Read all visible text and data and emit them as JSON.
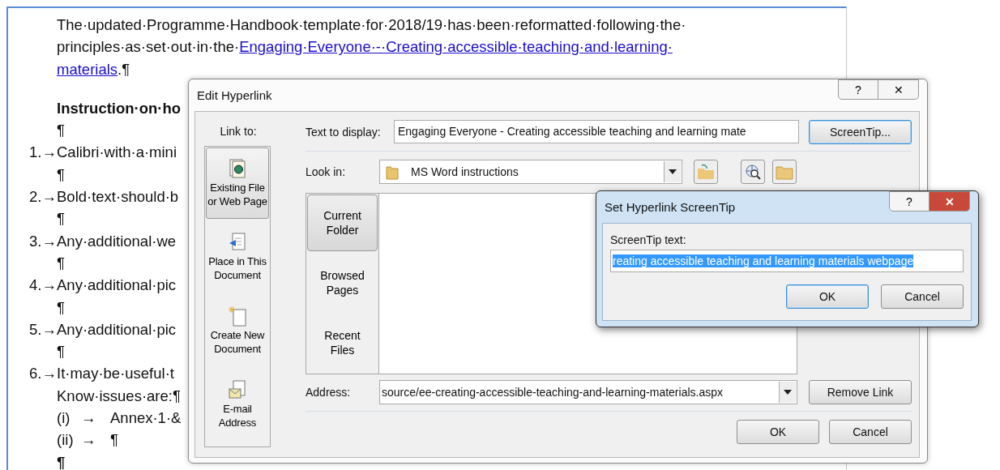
{
  "document": {
    "intro": {
      "line1": "The·updated·Programme·Handbook·template·for·2018/19·has·been·reformatted·following·the·",
      "line2": "principles·as·set·out·in·the·",
      "link_part1": "Engaging·Everyone·-·Creating·accessible·teaching·and·learning·",
      "link_part2": "materials",
      "after": ".¶"
    },
    "lines": [
      {
        "kind": "heading",
        "text": "Instruction·on·ho"
      },
      {
        "kind": "pilcrow",
        "text": "¶"
      },
      {
        "kind": "numbered",
        "number": "1.→",
        "text": "Calibri·with·a·mini"
      },
      {
        "kind": "pilcrow",
        "text": "¶"
      },
      {
        "kind": "numbered",
        "number": "2.→",
        "text": "Bold·text·should·b"
      },
      {
        "kind": "pilcrow",
        "text": "¶"
      },
      {
        "kind": "numbered",
        "number": "3.→",
        "text": "Any·additional·we"
      },
      {
        "kind": "pilcrow",
        "text": "¶"
      },
      {
        "kind": "numbered",
        "number": "4.→",
        "text": "Any·additional·pic"
      },
      {
        "kind": "pilcrow",
        "text": "¶"
      },
      {
        "kind": "numbered",
        "number": "5.→",
        "text": "Any·additional·pic"
      },
      {
        "kind": "pilcrow",
        "text": "¶"
      },
      {
        "kind": "numbered",
        "number": "6.→",
        "text": "It·may·be·useful·t"
      },
      {
        "kind": "plain",
        "text": "Know·issues·are:¶"
      },
      {
        "kind": "sub",
        "number": "(i)",
        "arrow": "→",
        "text": "Annex·1·&"
      },
      {
        "kind": "sub",
        "number": "(ii)",
        "arrow": "→",
        "text": "¶"
      },
      {
        "kind": "heading",
        "text": "¶"
      }
    ]
  },
  "edit_hyperlink": {
    "title": "Edit Hyperlink",
    "help": "?",
    "close": "✕",
    "link_to_label": "Link to:",
    "link_to": [
      {
        "label": "Existing File or Web Page",
        "kind": "file",
        "selected": true
      },
      {
        "label": "Place in This Document",
        "kind": "place",
        "selected": false
      },
      {
        "label": "Create New Document",
        "kind": "new",
        "selected": false
      },
      {
        "label": "E-mail Address",
        "kind": "mail",
        "selected": false
      }
    ],
    "text_to_display": {
      "label": "Text to display:",
      "value": "Engaging Everyone - Creating accessible teaching and learning mate"
    },
    "screentip_button": "ScreenTip...",
    "look_in": {
      "label": "Look in:",
      "value": "MS Word instructions"
    },
    "browse_tabs": [
      {
        "label": "Current Folder",
        "selected": true
      },
      {
        "label": "Browsed Pages",
        "selected": false
      },
      {
        "label": "Recent Files",
        "selected": false
      }
    ],
    "address": {
      "label": "Address:",
      "value": "source/ee-creating-accessible-teaching-and-learning-materials.aspx"
    },
    "remove_link": "Remove Link",
    "ok": "OK",
    "cancel": "Cancel"
  },
  "screentip_dialog": {
    "title": "Set Hyperlink ScreenTip",
    "help": "?",
    "close": "✕",
    "label": "ScreenTip text:",
    "value": "reating accessible teaching and learning materials webpage",
    "value_selected": true,
    "buttons": [
      {
        "label": "OK",
        "default": true
      },
      {
        "label": "Cancel",
        "default": false
      }
    ]
  }
}
